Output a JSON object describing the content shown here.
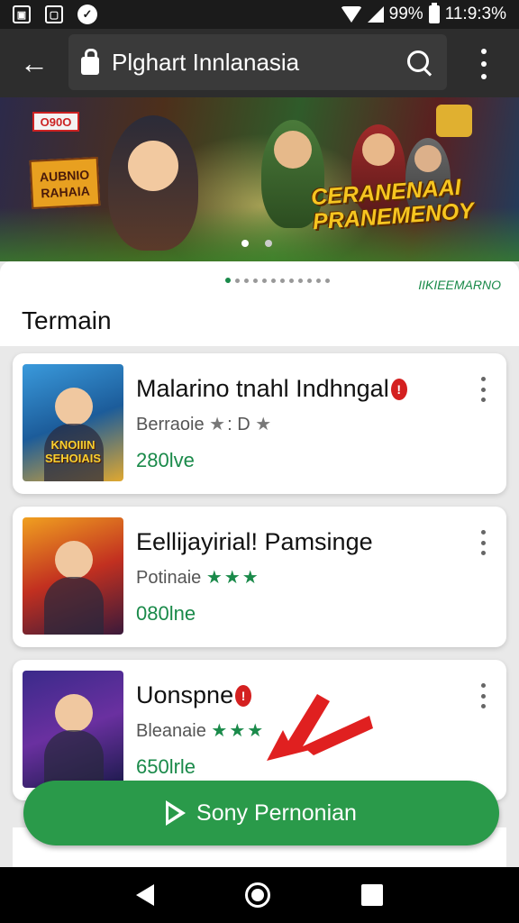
{
  "status_bar": {
    "battery_text": "99%",
    "time": "11:9:3%"
  },
  "app_bar": {
    "url": "Plghart Innlanasia"
  },
  "banner": {
    "tag_left": "O90O",
    "title_left": "AUBNIO RAHAIA",
    "title_right": "CERANENAAI PRANEMENOY"
  },
  "section": {
    "title": "Termain",
    "link": "IIKIEEMARNO"
  },
  "cards": [
    {
      "title": "Malarino tnahl Indhngal",
      "subtitle": "Berraoie",
      "rating": "D",
      "stars": "★",
      "price": "280lve",
      "thumb_label": "KNOIIIN SEHOIAIS"
    },
    {
      "title": "Eellijayirial! Pamsinge",
      "subtitle": "Potinaie",
      "stars": "★★★",
      "price": "080lne"
    },
    {
      "title": "Uonspne",
      "subtitle": "Bleanaie",
      "stars": "★★★",
      "price": "650lrle"
    }
  ],
  "cta": {
    "label": "Sony Pernonian"
  },
  "colors": {
    "accent": "#2a9a4a",
    "badge": "#d42020"
  }
}
